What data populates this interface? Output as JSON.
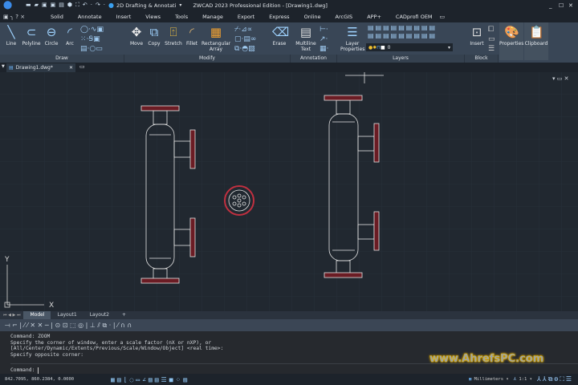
{
  "title_bar": {
    "workspace": "2D Drafting & Annotati",
    "title": "ZWCAD 2023 Professional Edition - [Drawing1.dwg]",
    "minimize": "_",
    "maximize": "☐",
    "close": "✕"
  },
  "menu_tabs": [
    "Solid",
    "Annotate",
    "Insert",
    "Views",
    "Tools",
    "Manage",
    "Export",
    "Express",
    "Online",
    "ArcGIS",
    "APP+",
    "CADprofi OEM"
  ],
  "ribbon": {
    "draw": {
      "label": "Draw",
      "tools": [
        "Line",
        "Polyline",
        "Circle",
        "Arc"
      ]
    },
    "modify": {
      "label": "Modify",
      "tools": [
        "Move",
        "Copy",
        "Stretch",
        "Fillet",
        "Rectangular Array",
        "Erase"
      ]
    },
    "annotation": {
      "label": "Annotation",
      "tools": [
        "Multiline Text"
      ]
    },
    "layers": {
      "label": "Layers",
      "tools": [
        "Layer Properties"
      ],
      "current_layer": "0"
    },
    "block": {
      "label": "Block",
      "tools": [
        "Insert"
      ]
    },
    "other": [
      "Properties",
      "Clipboard"
    ]
  },
  "document_tab": "Drawing1.dwg*",
  "layout_tabs": [
    "Model",
    "Layout1",
    "Layout2",
    "+"
  ],
  "axes": {
    "x": "X",
    "y": "Y"
  },
  "command_history": [
    "Command: ZOOM",
    "Specify the corner of window, enter a scale factor (nX or nXP), or",
    "[All/Center/Dynamic/Extents/Previous/Scale/Window/Object] <real time>:",
    "Specify opposite corner:"
  ],
  "command_prompt": "Command:",
  "status": {
    "coordinates": "842.7095, 860.2384, 0.0000",
    "units": "Millimeters",
    "scale": "1:1"
  },
  "watermark": "www.AhrefsPC.com",
  "colors": {
    "ribbon": "#394656",
    "canvas": "#212830",
    "drawing_line": "#e8e8e8",
    "flange": "#b0202a",
    "accent": "#4aa3e8"
  }
}
